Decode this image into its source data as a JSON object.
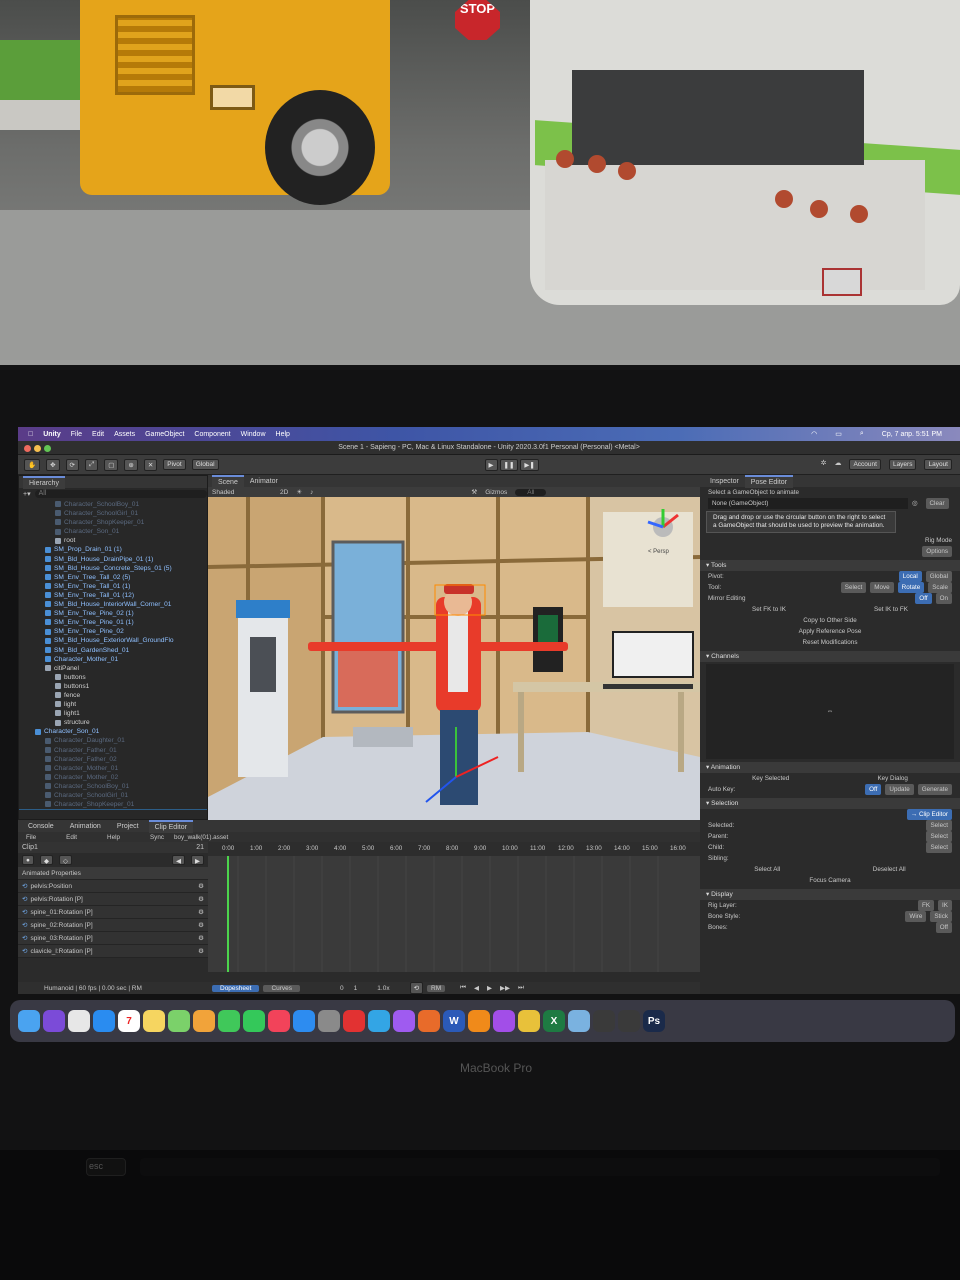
{
  "game_view": {
    "stop_sign": "STOP"
  },
  "menubar": {
    "items": [
      "Unity",
      "File",
      "Edit",
      "Assets",
      "GameObject",
      "Component",
      "Window",
      "Help"
    ],
    "datetime": "Ср, 7 апр.  5:51 PM"
  },
  "window_title": "Scene 1 - Sapieng - PC, Mac & Linux Standalone - Unity 2020.3.0f1 Personal (Personal) <Metal>",
  "toolbar": {
    "pivot": "Pivot",
    "global": "Global",
    "account": "Account",
    "layers": "Layers",
    "layout": "Layout"
  },
  "hierarchy": {
    "tab": "Hierarchy",
    "search_label": "All",
    "rows": [
      {
        "label": "Character_SchoolBoy_01",
        "indent": 3,
        "faded": true
      },
      {
        "label": "Character_SchoolGirl_01",
        "indent": 3,
        "faded": true
      },
      {
        "label": "Character_ShopKeeper_01",
        "indent": 3,
        "faded": true
      },
      {
        "label": "Character_Son_01",
        "indent": 3,
        "faded": true
      },
      {
        "label": "root",
        "indent": 3,
        "faded": false
      },
      {
        "label": "SM_Prop_Drain_01 (1)",
        "indent": 2,
        "faded": false,
        "blue": true
      },
      {
        "label": "SM_Bld_House_DrainPipe_01 (1)",
        "indent": 2,
        "faded": false,
        "blue": true
      },
      {
        "label": "SM_Bld_House_Concrete_Steps_01 (5)",
        "indent": 2,
        "faded": false,
        "blue": true
      },
      {
        "label": "SM_Env_Tree_Tall_02 (5)",
        "indent": 2,
        "faded": false,
        "blue": true
      },
      {
        "label": "SM_Env_Tree_Tall_01 (1)",
        "indent": 2,
        "faded": false,
        "blue": true
      },
      {
        "label": "SM_Env_Tree_Tall_01 (12)",
        "indent": 2,
        "faded": false,
        "blue": true
      },
      {
        "label": "SM_Bld_House_InteriorWall_Corner_01",
        "indent": 2,
        "faded": false,
        "blue": true
      },
      {
        "label": "SM_Env_Tree_Pine_02 (1)",
        "indent": 2,
        "faded": false,
        "blue": true
      },
      {
        "label": "SM_Env_Tree_Pine_01 (1)",
        "indent": 2,
        "faded": false,
        "blue": true
      },
      {
        "label": "SM_Env_Tree_Pine_02",
        "indent": 2,
        "faded": false,
        "blue": true
      },
      {
        "label": "SM_Bld_House_ExteriorWall_GroundFlo",
        "indent": 2,
        "faded": false,
        "blue": true
      },
      {
        "label": "SM_Bld_GardenShed_01",
        "indent": 2,
        "faded": false,
        "blue": true
      },
      {
        "label": "Character_Mother_01",
        "indent": 2,
        "faded": false,
        "blue": true
      },
      {
        "label": "citiPanel",
        "indent": 2,
        "faded": false
      },
      {
        "label": "buttons",
        "indent": 3,
        "faded": false
      },
      {
        "label": "buttons1",
        "indent": 3,
        "faded": false
      },
      {
        "label": "fence",
        "indent": 3,
        "faded": false
      },
      {
        "label": "light",
        "indent": 3,
        "faded": false
      },
      {
        "label": "light1",
        "indent": 3,
        "faded": false
      },
      {
        "label": "structure",
        "indent": 3,
        "faded": false
      },
      {
        "label": "Character_Son_01",
        "indent": 1,
        "faded": false,
        "blue": true
      },
      {
        "label": "Character_Daughter_01",
        "indent": 2,
        "faded": true
      },
      {
        "label": "Character_Father_01",
        "indent": 2,
        "faded": true
      },
      {
        "label": "Character_Father_02",
        "indent": 2,
        "faded": true
      },
      {
        "label": "Character_Mother_01",
        "indent": 2,
        "faded": true
      },
      {
        "label": "Character_Mother_02",
        "indent": 2,
        "faded": true
      },
      {
        "label": "Character_SchoolBoy_01",
        "indent": 2,
        "faded": true
      },
      {
        "label": "Character_SchoolGirl_01",
        "indent": 2,
        "faded": true
      },
      {
        "label": "Character_ShopKeeper_01",
        "indent": 2,
        "faded": true
      },
      {
        "label": "Character_Son_01",
        "indent": 2,
        "faded": false,
        "selected": true
      }
    ]
  },
  "scene": {
    "tabs": [
      "Scene",
      "Animator"
    ],
    "shading": "Shaded",
    "mode_2d": "2D",
    "gizmos": "Gizmos",
    "all": "All",
    "persp": "< Persp"
  },
  "inspector": {
    "tabs": [
      "Inspector",
      "Pose Editor"
    ],
    "prompt": "Select a GameObject to animate",
    "field_value": "None (GameObject)",
    "clear": "Clear",
    "tooltip": "Drag and drop or use the circular button on the right to select a GameObject that should be used to preview the animation.",
    "rig_mode": "Rig Mode",
    "options": "Options",
    "tools": {
      "title": "Tools",
      "pivot_label": "Pivot:",
      "local": "Local",
      "global": "Global",
      "tool_label": "Tool:",
      "select": "Select",
      "move": "Move",
      "rotate": "Rotate",
      "scale": "Scale",
      "mirror_label": "Mirror Editing",
      "off": "Off",
      "on": "On",
      "set_fk": "Set FK to IK",
      "set_ik": "Set IK to FK",
      "copy_side": "Copy to Other Side",
      "apply_ref": "Apply Reference Pose",
      "reset_mods": "Reset Modifications"
    },
    "channels": {
      "title": "Channels",
      "glyph": "⇔"
    },
    "animation": {
      "title": "Animation",
      "key_selected": "Key Selected",
      "key_dialog": "Key Dialog",
      "auto_key": "Auto Key:",
      "off": "Off",
      "update": "Update",
      "generate": "Generate"
    },
    "selection": {
      "title": "Selection",
      "clip_editor": "→ Clip Editor",
      "selected": "Selected:",
      "parent": "Parent:",
      "child": "Child:",
      "sibling": "Sibling:",
      "select": "Select",
      "select_all": "Select All",
      "deselect_all": "Deselect All",
      "focus_camera": "Focus Camera"
    },
    "display": {
      "title": "Display",
      "rig_layer": "Rig Layer:",
      "fk": "FK",
      "ik": "IK",
      "bone_style": "Bone Style:",
      "wire": "Wire",
      "stick": "Stick",
      "bones": "Bones:",
      "off": "Off"
    }
  },
  "animation_window": {
    "tabs": [
      "Console",
      "Animation",
      "Project",
      "Clip Editor"
    ],
    "menu": [
      "File",
      "Edit",
      "Help"
    ],
    "sync": "Sync",
    "asset": "boy_walk(01).asset",
    "clip": "Clip1",
    "frame": "21",
    "animated_properties": "Animated Properties",
    "properties": [
      {
        "name": "pelvis",
        "prop": "Position"
      },
      {
        "name": "pelvis",
        "prop": "Rotation [P]"
      },
      {
        "name": "spine_01",
        "prop": "Rotation [P]"
      },
      {
        "name": "spine_02",
        "prop": "Rotation [P]"
      },
      {
        "name": "spine_03",
        "prop": "Rotation [P]"
      },
      {
        "name": "clavicle_l",
        "prop": "Rotation [P]"
      }
    ],
    "timeline_labels": [
      "0:00",
      "1:00",
      "2:00",
      "3:00",
      "4:00",
      "5:00",
      "6:00",
      "7:00",
      "8:00",
      "9:00",
      "10:00",
      "11:00",
      "12:00",
      "13:00",
      "14:00",
      "15:00",
      "16:00"
    ],
    "status": "Humanoid | 60 fps | 0.00 sec | RM",
    "dopesheet": "Dopesheet",
    "curves": "Curves",
    "frame_start": "0",
    "frame_step": "1",
    "speed": "1.0x",
    "rm": "RM"
  },
  "dock": {
    "icons": [
      "finder-icon",
      "siri-icon",
      "launchpad-icon",
      "safari-icon",
      "calendar-icon",
      "notes-icon",
      "maps-icon",
      "photos-icon",
      "messages-icon",
      "facetime-icon",
      "music-icon",
      "appstore-icon",
      "settings-icon",
      "opera-icon",
      "telegram-icon",
      "messenger-icon",
      "app-icon",
      "word-icon",
      "books-icon",
      "podcasts-icon",
      "chrome-icon",
      "excel-icon",
      "preview-icon",
      "unity-icon",
      "unity-hub-icon",
      "photoshop-icon"
    ],
    "calendar_day": "7",
    "word": "W",
    "excel": "X",
    "photoshop": "Ps"
  },
  "laptop": {
    "brand": "MacBook Pro",
    "esc": "esc"
  }
}
